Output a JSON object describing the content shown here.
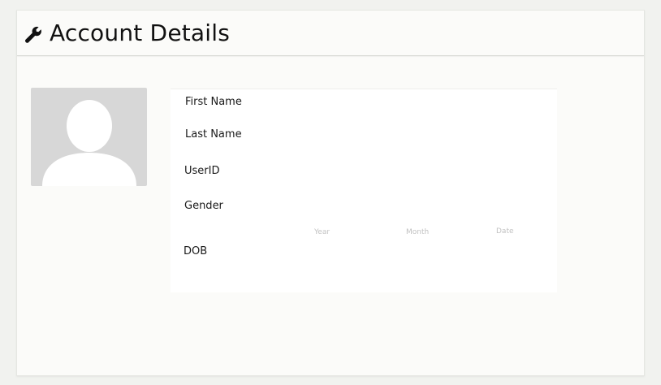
{
  "header": {
    "title": "Account Details",
    "icon": "wrench-icon"
  },
  "profile": {
    "avatar_icon": "user-silhouette-icon"
  },
  "form": {
    "fields": [
      {
        "label": "First Name"
      },
      {
        "label": "Last Name"
      },
      {
        "label": "UserID"
      },
      {
        "label": "Gender"
      }
    ],
    "dob": {
      "label": "DOB",
      "year_placeholder": "Year",
      "month_placeholder": "Month",
      "date_placeholder": "Date"
    }
  },
  "colors": {
    "page_background": "#f1f2ef",
    "card_background": "#fbfbf9",
    "avatar_background": "#d7d7d7",
    "avatar_figure": "#ffffff",
    "placeholder_text": "#c2c2c2"
  }
}
